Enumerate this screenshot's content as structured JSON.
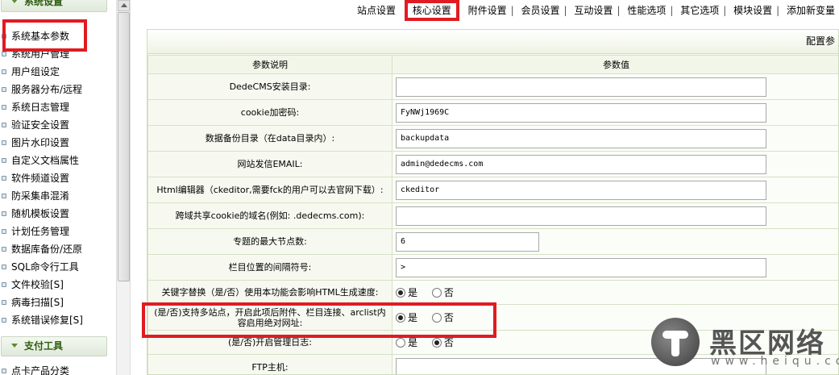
{
  "sidebar": {
    "section_system": "系统设置",
    "items": [
      {
        "label": "系统基本参数"
      },
      {
        "label": "系统用户管理"
      },
      {
        "label": "用户组设定"
      },
      {
        "label": "服务器分布/远程"
      },
      {
        "label": "系统日志管理"
      },
      {
        "label": "验证安全设置"
      },
      {
        "label": "图片水印设置"
      },
      {
        "label": "自定义文档属性"
      },
      {
        "label": "软件频道设置"
      },
      {
        "label": "防采集串混淆"
      },
      {
        "label": "随机模板设置"
      },
      {
        "label": "计划任务管理"
      },
      {
        "label": "数据库备份/还原"
      },
      {
        "label": "SQL命令行工具"
      },
      {
        "label": "文件校验[S]"
      },
      {
        "label": "病毒扫描[S]"
      },
      {
        "label": "系统错误修复[S]"
      }
    ],
    "section_pay": "支付工具",
    "pay_items": [
      {
        "label": "点卡产品分类"
      }
    ]
  },
  "topnav": {
    "tabs": [
      "站点设置",
      "核心设置",
      "附件设置",
      "会员设置",
      "互动设置",
      "性能选项",
      "其它选项",
      "模块设置",
      "添加新变量"
    ],
    "active": "核心设置"
  },
  "panel": {
    "title": "配置参"
  },
  "table": {
    "col_desc": "参数说明",
    "col_value": "参数值",
    "rows": [
      {
        "label": "DedeCMS安装目录:",
        "value": ""
      },
      {
        "label": "cookie加密码:",
        "value": "FyNWj1969C"
      },
      {
        "label": "数据备份目录（在data目录内）:",
        "value": "backupdata"
      },
      {
        "label": "网站发信EMAIL:",
        "value": "admin@dedecms.com"
      },
      {
        "label": "Html编辑器（ckeditor,需要fck的用户可以去官网下载）:",
        "value": "ckeditor"
      },
      {
        "label": "跨域共享cookie的域名(例如: .dedecms.com):",
        "value": ""
      },
      {
        "label": "专题的最大节点数:",
        "value": "6"
      },
      {
        "label": "栏目位置的间隔符号:",
        "value": " > "
      },
      {
        "label": "关键字替换（是/否）使用本功能会影响HTML生成速度:",
        "yes": "是",
        "no": "否",
        "selected": "yes"
      },
      {
        "label": "(是/否)支持多站点，开启此项后附件、栏目连接、arclist内容启用绝对网址:",
        "yes": "是",
        "no": "否",
        "selected": "yes"
      },
      {
        "label": "(是/否)开启管理日志:",
        "yes": "是",
        "no": "否",
        "selected": "no"
      },
      {
        "label": "FTP主机:",
        "value": ""
      }
    ]
  },
  "watermark": {
    "title": "黑区网络",
    "url": "www.heiqu.com"
  }
}
